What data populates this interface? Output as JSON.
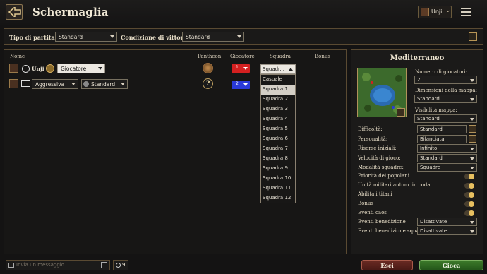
{
  "header": {
    "title": "Schermaglia",
    "user": "Unji"
  },
  "settings": {
    "game_type_label": "Tipo di partita:",
    "game_type_value": "Standard",
    "victory_label": "Condizione di vittoria:",
    "victory_value": "Standard"
  },
  "columns": {
    "name": "Nome",
    "pantheon": "Pantheon",
    "player": "Giocatore",
    "team": "Squadra",
    "bonus": "Bonus"
  },
  "players": [
    {
      "name": "Unji",
      "type": "Giocatore",
      "color_number": "1",
      "color": "#d42020",
      "team": "Squadr..."
    },
    {
      "personality": "Aggressiva",
      "difficulty": "Standard",
      "color_number": "2",
      "color": "#2a3ad8"
    }
  ],
  "team_dropdown": {
    "options": [
      "Casuale",
      "Squadra 1",
      "Squadra 2",
      "Squadra 3",
      "Squadra 4",
      "Squadra 5",
      "Squadra 6",
      "Squadra 7",
      "Squadra 8",
      "Squadra 9",
      "Squadra 10",
      "Squadra 11",
      "Squadra 12"
    ],
    "selected": "Squadra 1"
  },
  "map": {
    "title": "Mediterraneo",
    "num_players_label": "Numero di giocatori:",
    "num_players_value": "2",
    "map_size_label": "Dimensioni della mappa:",
    "map_size_value": "Standard",
    "visibility_label": "Visibilità mappa:",
    "visibility_value": "Standard",
    "difficulty_label": "Difficoltà:",
    "difficulty_value": "Standard",
    "personality_label": "Personalità:",
    "personality_value": "Bilanciata",
    "resources_label": "Risorse iniziali:",
    "resources_value": "Infinito",
    "speed_label": "Velocità di gioco:",
    "speed_value": "Standard",
    "team_mode_label": "Modalità squadre:",
    "team_mode_value": "Squadre",
    "toggles": [
      "Priorità dei popolani",
      "Unità militari autom. in coda",
      "Abilita i titani",
      "Bonus",
      "Eventi caos"
    ],
    "blessing_label": "Eventi benedizione",
    "blessing_value": "Disattivate",
    "blessing_team_label": "Eventi benedizione squa...",
    "blessing_team_value": "Disattivate"
  },
  "footer": {
    "chat_placeholder": "Invia un messaggio",
    "players_count": "9",
    "exit_label": "Esci",
    "play_label": "Gioca"
  },
  "colors": {
    "accent": "#b0925a",
    "exit": "#6a2a22",
    "play": "#3c7a2a"
  }
}
